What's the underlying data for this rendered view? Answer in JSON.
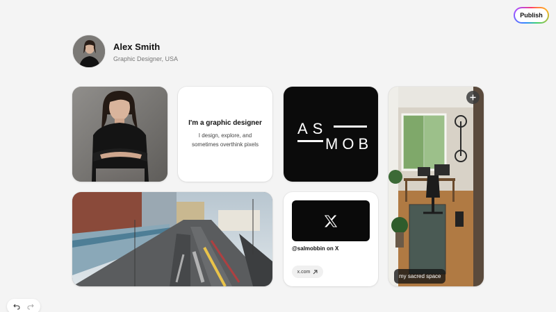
{
  "toolbar": {
    "publish_label": "Publish"
  },
  "profile": {
    "name": "Alex Smith",
    "subtitle": "Graphic Designer, USA"
  },
  "cards": {
    "bio": {
      "title": "I'm a graphic designer",
      "body_line1": "I design, explore, and",
      "body_line2": "sometimes overthink pixels"
    },
    "logo": {
      "line1": "AS",
      "line2": "MOB"
    },
    "social": {
      "handle": "@salmobbin on X",
      "link_label": "x.com",
      "link_icon": "arrow-up-right-icon",
      "logo_icon": "x-logo-icon"
    },
    "room": {
      "caption": "my sacred space",
      "add_icon": "plus-icon"
    }
  },
  "history": {
    "undo_icon": "undo-icon",
    "redo_icon": "redo-icon"
  },
  "colors": {
    "background": "#f4f4f4",
    "card": "#ffffff",
    "dark": "#0b0b0b"
  }
}
